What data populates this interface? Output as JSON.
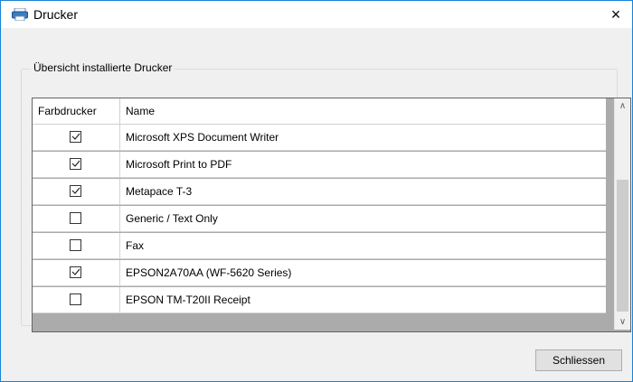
{
  "window": {
    "title": "Drucker",
    "close_glyph": "×"
  },
  "group": {
    "legend": "Übersicht installierte Drucker"
  },
  "grid": {
    "columns": [
      "Farbdrucker",
      "Name"
    ],
    "rows": [
      {
        "color": true,
        "name": "Microsoft XPS Document Writer"
      },
      {
        "color": true,
        "name": "Microsoft Print to PDF"
      },
      {
        "color": true,
        "name": "Metapace T-3"
      },
      {
        "color": false,
        "name": "Generic / Text Only"
      },
      {
        "color": false,
        "name": "Fax"
      },
      {
        "color": true,
        "name": "EPSON2A70AA (WF-5620 Series)"
      },
      {
        "color": false,
        "name": "EPSON TM-T20II Receipt"
      }
    ]
  },
  "scrollbar": {
    "up_glyph": "∧",
    "down_glyph": "∨"
  },
  "buttons": {
    "close_label": "Schliessen"
  },
  "icons": {
    "app": "printer-icon",
    "close": "close-icon",
    "check": "checkmark-icon"
  },
  "colors": {
    "accent_border": "#1883d7",
    "grid_empty": "#ababab"
  }
}
